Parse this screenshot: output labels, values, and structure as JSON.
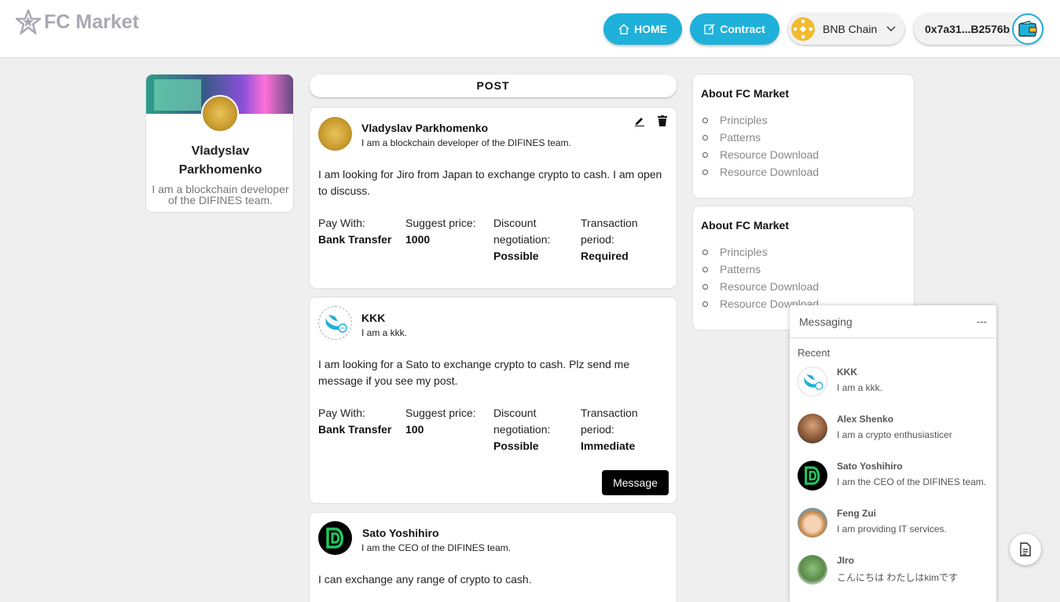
{
  "app": {
    "title": "FC Market"
  },
  "nav": {
    "home": "HOME",
    "contract": "Contract",
    "chain": "BNB Chain",
    "wallet": "0x7a31...B2576b"
  },
  "profile": {
    "name_line1": "Vladyslav",
    "name_line2": "Parkhomenko",
    "bio": "I am a blockchain developer of the DIFINES team."
  },
  "feed": {
    "header": "POST",
    "posts": [
      {
        "name": "Vladyslav Parkhomenko",
        "bio": "I am a blockchain developer of the DIFINES team.",
        "text": "I am looking for Jiro from Japan to exchange crypto to cash. I am open to discuss.",
        "pay_label": "Pay With:",
        "pay": "Bank Transfer",
        "price_label": "Suggest price:",
        "price": "1000",
        "disc_label1": "Discount",
        "disc_label2": "negotiation:",
        "disc": "Possible",
        "period_label1": "Transaction",
        "period_label2": "period:",
        "period": "Required"
      },
      {
        "name": "KKK",
        "bio": "I am a kkk.",
        "text": "I am looking for a Sato to exchange crypto to cash. Plz send me message if you see my post.",
        "pay_label": "Pay With:",
        "pay": "Bank Transfer",
        "price_label": "Suggest price:",
        "price": "100",
        "disc_label1": "Discount",
        "disc_label2": "negotiation:",
        "disc": "Possible",
        "period_label1": "Transaction",
        "period_label2": "period:",
        "period": "Immediate",
        "button": "Message"
      },
      {
        "name": "Sato Yoshihiro",
        "bio": "I am the CEO of the DIFINES team.",
        "text": "I can exchange any range of crypto to cash."
      }
    ]
  },
  "about": [
    {
      "title": "About FC Market",
      "items": [
        "Principles",
        "Patterns",
        "Resource Download",
        "Resource Download"
      ]
    },
    {
      "title": "About FC Market",
      "items": [
        "Principles",
        "Patterns",
        "Resource Download",
        "Resource Download"
      ]
    }
  ],
  "messaging": {
    "title": "Messaging",
    "minimize": "---",
    "recent": "Recent",
    "contacts": [
      {
        "name": "KKK",
        "status": "I am a kkk."
      },
      {
        "name": "Alex Shenko",
        "status": "I am a crypto enthusiasticer"
      },
      {
        "name": "Sato Yoshihiro",
        "status": "I am the CEO of the DIFINES team."
      },
      {
        "name": "Feng Zui",
        "status": "I am providing IT services."
      },
      {
        "name": "JIro",
        "status": "こんにちは わたしはkimです"
      }
    ]
  },
  "colors": {
    "accent": "#1fb1d9",
    "background": "#efefef",
    "gold": "#c99a2e",
    "difines_green": "#22c55e"
  }
}
